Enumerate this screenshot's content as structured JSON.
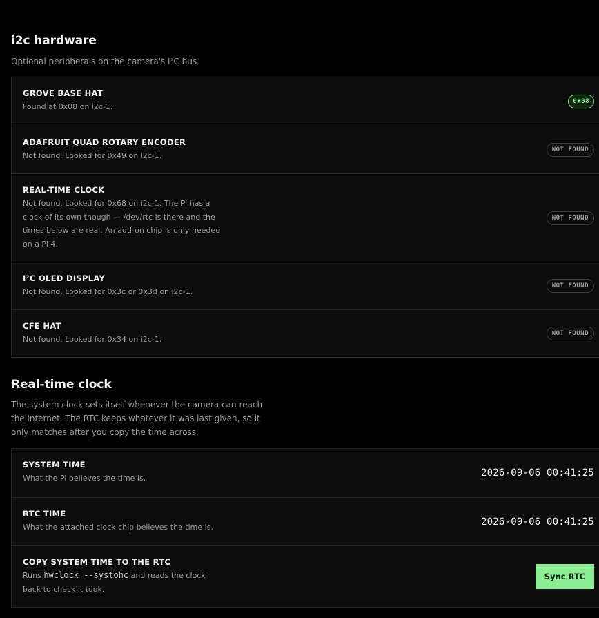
{
  "i2c": {
    "title": "i2c hardware",
    "description": "Optional peripherals on the camera's I²C bus.",
    "rows": [
      {
        "title": "GROVE BASE HAT",
        "desc": "Found at 0x08 on i2c-1.",
        "badge": "0x08",
        "found": true
      },
      {
        "title": "ADAFRUIT QUAD ROTARY ENCODER",
        "desc": "Not found. Looked for 0x49 on i2c-1.",
        "badge": "NOT FOUND",
        "found": false
      },
      {
        "title": "REAL-TIME CLOCK",
        "desc": "Not found. Looked for 0x68 on i2c-1. The Pi has a clock of its own though — /dev/rtc is there and the times below are real. An add-on chip is only needed on a Pi 4.",
        "badge": "NOT FOUND",
        "found": false
      },
      {
        "title": "I²C OLED DISPLAY",
        "desc": "Not found. Looked for 0x3c or 0x3d on i2c-1.",
        "badge": "NOT FOUND",
        "found": false
      },
      {
        "title": "CFE HAT",
        "desc": "Not found. Looked for 0x34 on i2c-1.",
        "badge": "NOT FOUND",
        "found": false
      }
    ]
  },
  "rtc": {
    "title": "Real-time clock",
    "description": "The system clock sets itself whenever the camera can reach the internet. The RTC keeps whatever it was last given, so it only matches after you copy the time across.",
    "system_time": {
      "title": "SYSTEM TIME",
      "desc": "What the Pi believes the time is.",
      "value": "2026-09-06 00:41:25"
    },
    "rtc_time": {
      "title": "RTC TIME",
      "desc": "What the attached clock chip believes the time is.",
      "value": "2026-09-06 00:41:25"
    },
    "copy": {
      "title": "COPY SYSTEM TIME TO THE RTC",
      "desc_before": "Runs ",
      "desc_code": "hwclock --systohc",
      "desc_after": " and reads the clock back to check it took.",
      "button_label": "Sync RTC"
    }
  },
  "colors": {
    "accent": "#8bee93",
    "background": "#000000",
    "card": "#0c0c0c",
    "border": "#262626"
  }
}
